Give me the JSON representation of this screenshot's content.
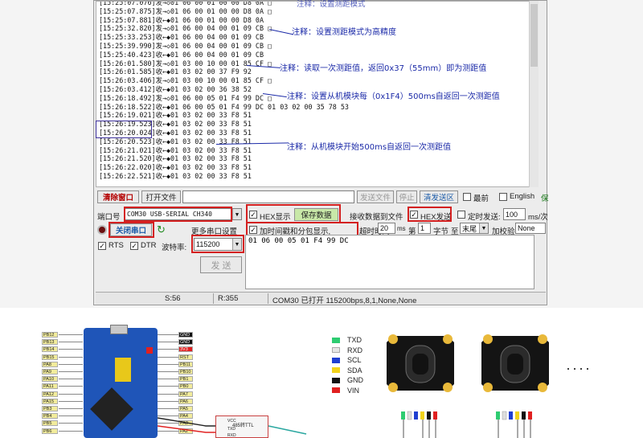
{
  "log_lines": [
    "[15:25:07.076]发→◇01 06 00 01 00 00 D8 0A □",
    "[15:25:07.875]发→◇01 06 00 01 00 00 D8 0A □",
    "[15:25:07.881]收←◆01 06 00 01 00 00 D8 0A",
    "[15:25:32.820]发→◇01 06 00 04 00 01 09 CB □",
    "[15:25:33.253]收←◆01 06 00 04 00 01 09 CB",
    "[15:25:39.990]发→◇01 06 00 04 00 01 09 CB □",
    "[15:25:40.423]收←◆01 06 00 04 00 01 09 CB",
    "[15:26:01.580]发→◇01 03 00 10 00 01 85 CF □",
    "[15:26:01.585]收←◆01 03 02 00 37 F9 92",
    "[15:26:03.406]发→◇01 03 00 10 00 01 85 CF □",
    "[15:26:03.412]收←◆01 03 02 00 36 38 52",
    "[15:26:18.492]发→◇01 06 00 05 01 F4 99 DC □",
    "[15:26:18.522]收←◆01 06 00 05 01 F4 99 DC 01 03 02 00 35 78 53",
    "[15:26:19.021]收←◆01 03 02 00 33 F8 51",
    "[15:26:19.523]收←◆01 03 02 00 33 F8 51",
    "[15:26:20.024]收←◆01 03 02 00 33 F8 51",
    "[15:26:20.523]收←◆01 03 02 00 33 F8 51",
    "[15:26:21.021]收←◆01 03 02 00 33 F8 51",
    "[15:26:21.520]收←◆01 03 02 00 33 F8 51",
    "[15:26:22.020]收←◆01 03 02 00 33 F8 51",
    "[15:26:22.521]收←◆01 03 02 00 33 F8 51"
  ],
  "notes": {
    "n0": "注释：设置测距模式为高精度",
    "n1": "注释：读取一次测距值，返回0x37（55mm）即为测距值",
    "n2": "注释：设置从机模块每（0x1F4）500ms自返回一次测距值",
    "n3": "注释：从机模块开始500ms自返回一次测距值",
    "n_top": "注释：设置测距模式"
  },
  "toolbar": {
    "clear_window": "清除窗口",
    "open_file": "打开文件",
    "send_file": "发送文件",
    "stop": "停止",
    "clear_send": "清发送区",
    "topmost": "最前",
    "english": "English",
    "extra": "保"
  },
  "port": {
    "label": "端口号",
    "value": "COM30 USB-SERIAL CH340",
    "close_port": "关闭串口",
    "more_settings": "更多串口设置",
    "rts": "RTS",
    "dtr": "DTR",
    "baud_label": "波特率:",
    "baud_value": "115200"
  },
  "options": {
    "hex_display": "HEX显示",
    "save_data": "保存数据",
    "recv_to_file": "接收数据到文件",
    "hex_send": "HEX发送",
    "timed_send": "定时发送:",
    "timed_value": "100",
    "timed_unit": "ms/次",
    "timestamp": "加时间戳和分包显示,",
    "timeout_label": "超时时间:",
    "timeout_value": "20",
    "timeout_unit": "ms",
    "nth": "第",
    "byte_value": "1",
    "byte_label": "字节",
    "to": "至",
    "end_value": "末尾",
    "checksum_label": "加校验",
    "checksum_value": "None"
  },
  "send_box": {
    "content": "01 06 00 05 01 F4 99 DC",
    "send_button": "发 送"
  },
  "status_bar": {
    "sent": "S:56",
    "received": "R:355",
    "port_status": "COM30 已打开  115200bps,8,1,None,None"
  },
  "wiring": {
    "left_pins": [
      "PB12",
      "PB13",
      "PB14",
      "PB15",
      "PA8",
      "PA9",
      "PA10",
      "PA11",
      "PA12",
      "PA15",
      "PB3",
      "PB4",
      "PB5",
      "PB6"
    ],
    "right_pins": [
      "GND",
      "GND",
      "3V3",
      "RST",
      "PB11",
      "PB10",
      "PB1",
      "PB0",
      "PA7",
      "PA6",
      "PA5",
      "PA4",
      "PA3",
      "PA2"
    ],
    "converter_label": "485转TTL",
    "converter_pins": [
      "VCC",
      "TXD",
      "RXD"
    ],
    "legend": [
      {
        "label": "TXD",
        "color": "#2ecc71"
      },
      {
        "label": "RXD",
        "color": "#e6e6e6"
      },
      {
        "label": "SCL",
        "color": "#1f3fd1"
      },
      {
        "label": "SDA",
        "color": "#f1d21a"
      },
      {
        "label": "GND",
        "color": "#111111"
      },
      {
        "label": "VIN",
        "color": "#e02020"
      }
    ],
    "ellipsis": "····"
  }
}
